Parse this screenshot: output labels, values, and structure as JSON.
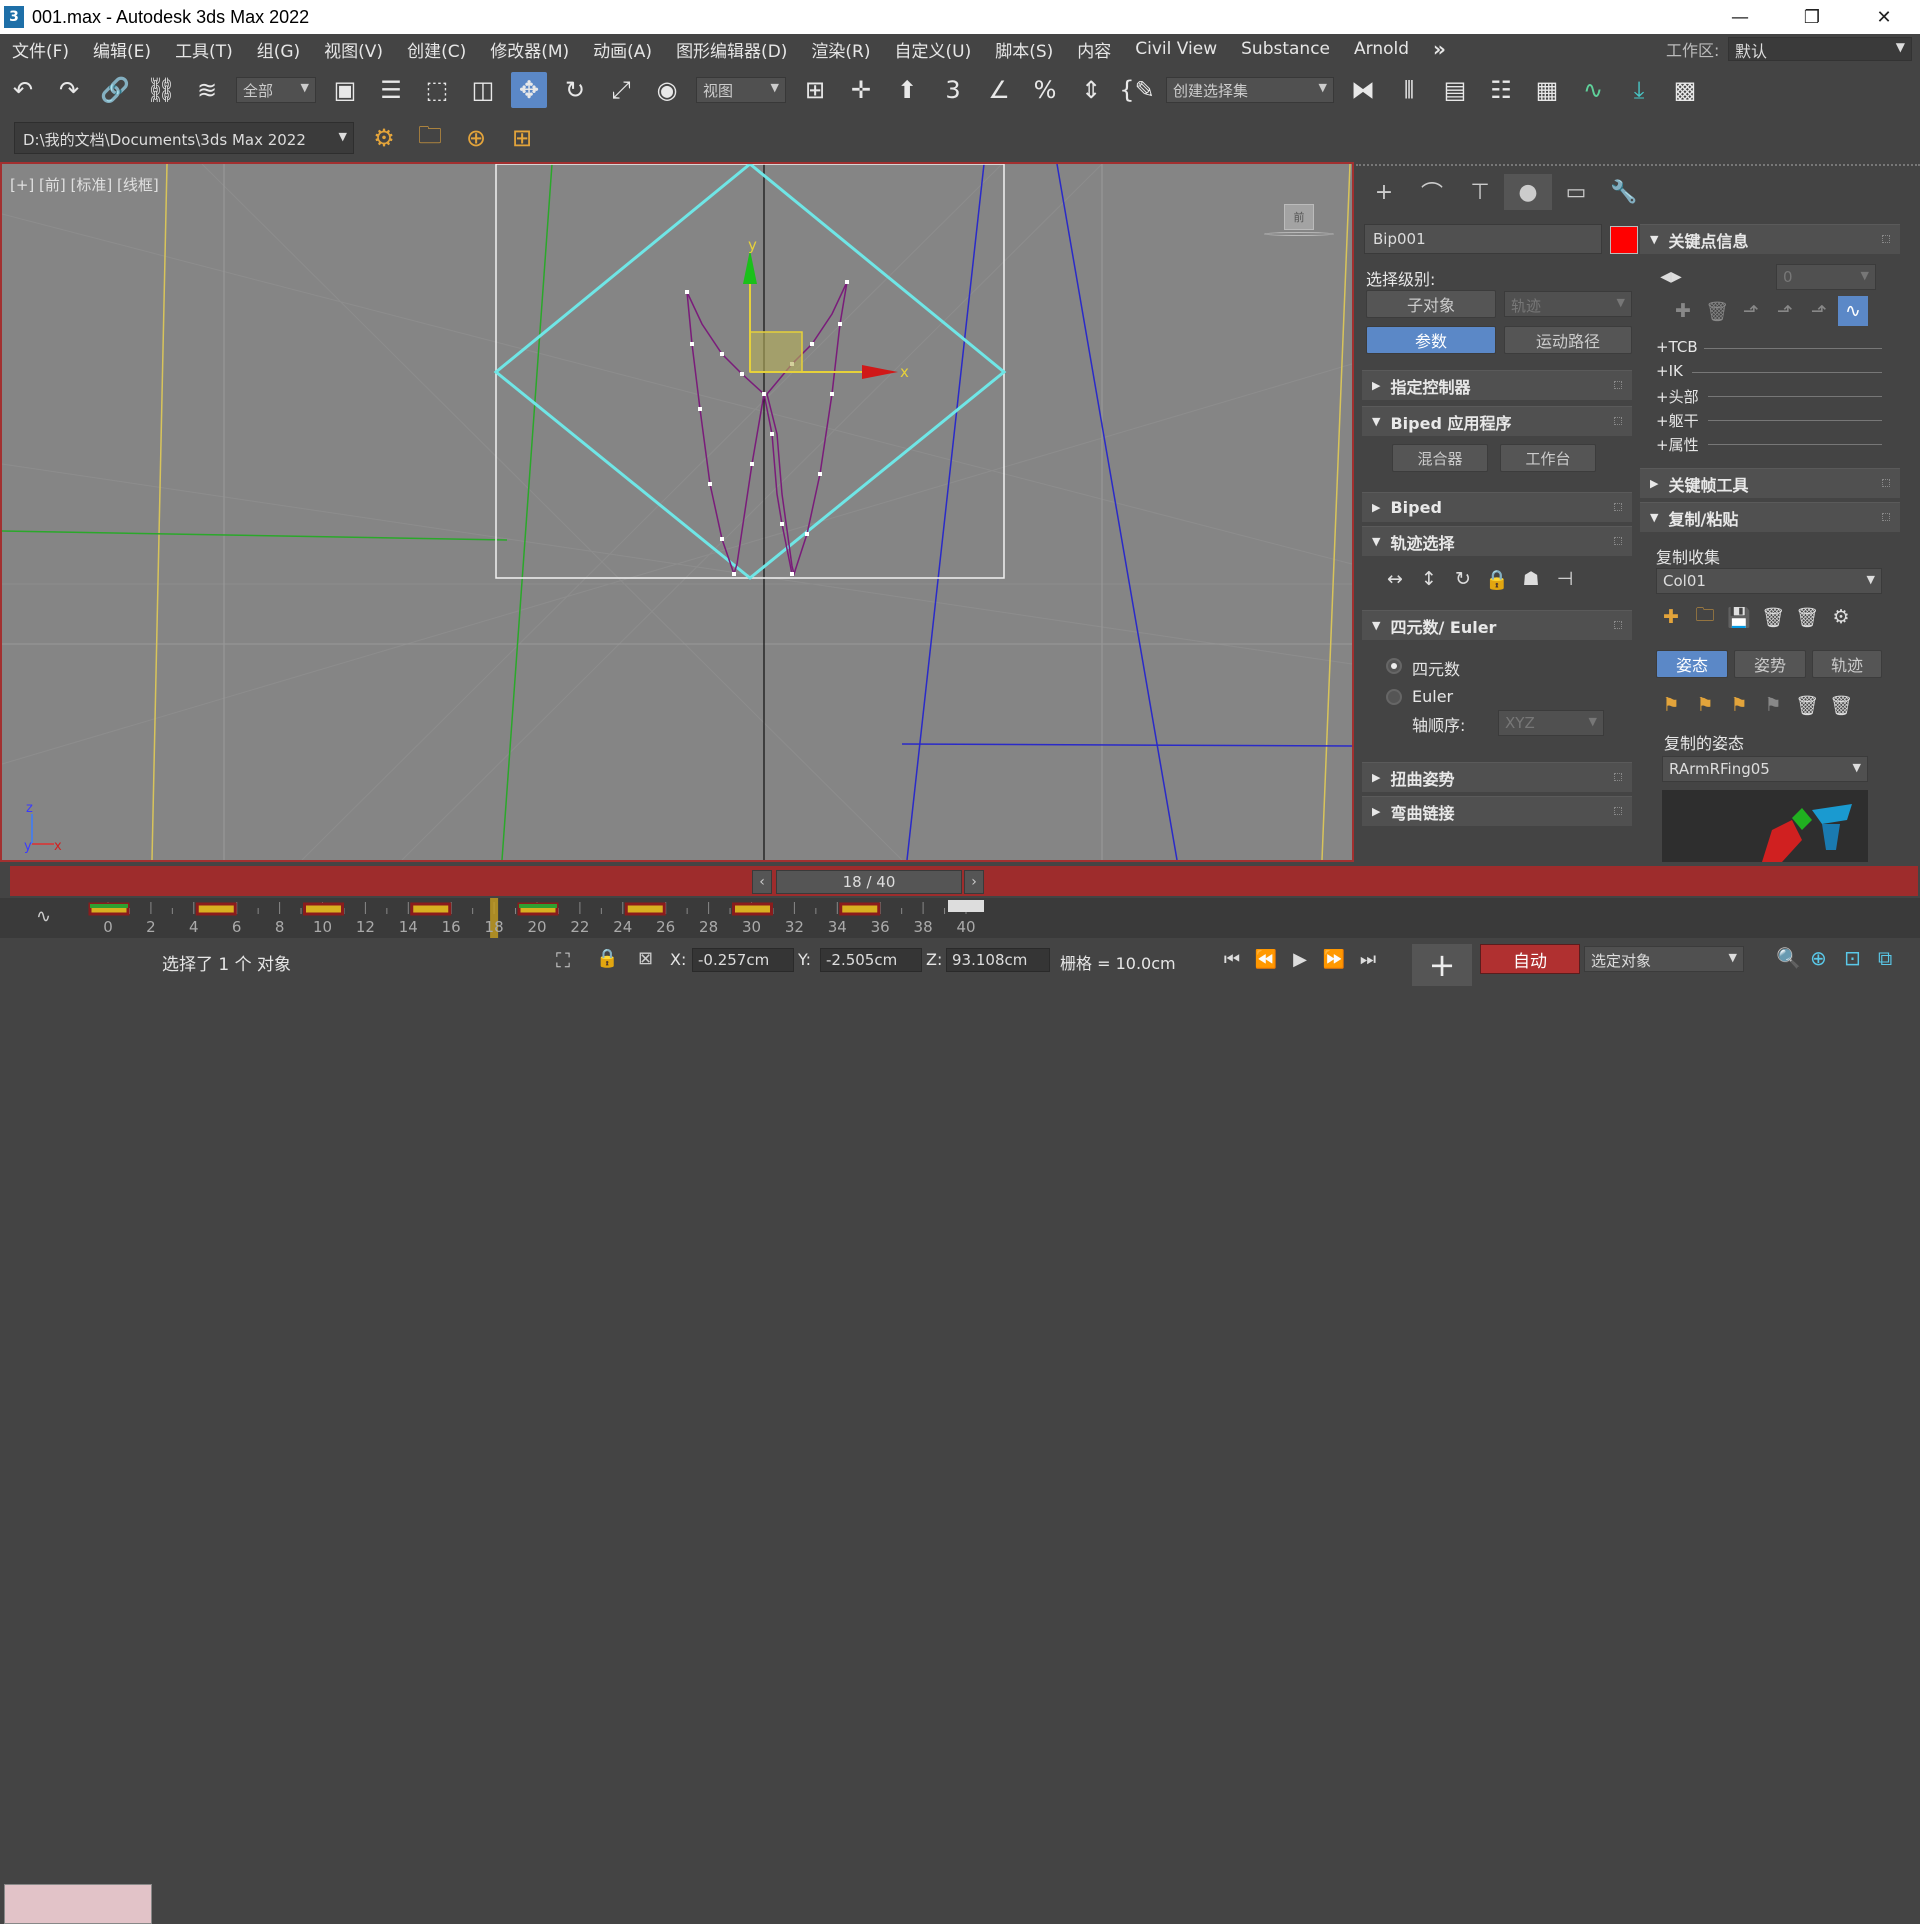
{
  "window": {
    "title": "001.max - Autodesk 3ds Max 2022",
    "app_icon": "3",
    "minimize": "—",
    "restore": "❐",
    "close": "✕"
  },
  "menu": {
    "items": [
      "文件(F)",
      "编辑(E)",
      "工具(T)",
      "组(G)",
      "视图(V)",
      "创建(C)",
      "修改器(M)",
      "动画(A)",
      "图形编辑器(D)",
      "渲染(R)",
      "自定义(U)",
      "脚本(S)",
      "内容",
      "Civil View",
      "Substance",
      "Arnold"
    ],
    "overflow": "»",
    "workspace_label": "工作区:",
    "workspace_value": "默认"
  },
  "toolbar": {
    "selection_filter": "全部",
    "ref_coord": "视图",
    "named_selection": "创建选择集",
    "angle_snap": "3",
    "percent_snap": "%"
  },
  "project": {
    "path": "D:\\我的文档\\Documents\\3ds Max 2022"
  },
  "viewport": {
    "label": "[+] [前] [标准] [线框]",
    "viewcube_label": "前",
    "gizmo_x": "x",
    "gizmo_y": "y",
    "axis_z": "z",
    "axis_y": "y",
    "axis_x": "x"
  },
  "command_panel": {
    "object_name": "Bip001",
    "object_color": "#ff0000",
    "selection_level_label": "选择级别:",
    "subobject_btn": "子对象",
    "trajectory_select": "轨迹",
    "params_btn": "参数",
    "motion_path_btn": "运动路径",
    "rollouts_left": [
      "指定控制器",
      "Biped 应用程序",
      "Biped",
      "轨迹选择",
      "四元数/ Euler",
      "扭曲姿势",
      "弯曲链接"
    ],
    "mixer_btn": "混合器",
    "workbench_btn": "工作台",
    "quaternion_label": "四元数",
    "euler_label": "Euler",
    "axis_order_label": "轴顺序:",
    "axis_order_value": "XYZ",
    "key_info_title": "关键点信息",
    "key_number": "0",
    "tracks": [
      "+TCB",
      "+IK",
      "+头部",
      "+躯干",
      "+属性"
    ],
    "keyframe_tools": "关键帧工具",
    "copy_paste": "复制/粘贴",
    "copy_collection_label": "复制收集",
    "copy_collection_value": "Col01",
    "tab_posture": "姿态",
    "tab_pose": "姿势",
    "tab_track": "轨迹",
    "copied_posture_label": "复制的姿态",
    "copied_posture_value": "RArmRFing05"
  },
  "timeline": {
    "slider": "18 / 40",
    "current_frame": 18,
    "total_frames": 40,
    "ticks": [
      "0",
      "2",
      "4",
      "6",
      "8",
      "10",
      "12",
      "14",
      "16",
      "18",
      "20",
      "22",
      "24",
      "26",
      "28",
      "30",
      "32",
      "34",
      "36",
      "38",
      "40"
    ],
    "keyframes": [
      0,
      5,
      10,
      15,
      20,
      25,
      30,
      35
    ]
  },
  "status": {
    "selection_text": "选择了 1 个 对象",
    "x_label": "X:",
    "x_value": "-0.257cm",
    "y_label": "Y:",
    "y_value": "-2.505cm",
    "z_label": "Z:",
    "z_value": "93.108cm",
    "grid_text": "栅格 = 10.0cm",
    "auto_key": "自动",
    "selected_objects": "选定对象"
  }
}
